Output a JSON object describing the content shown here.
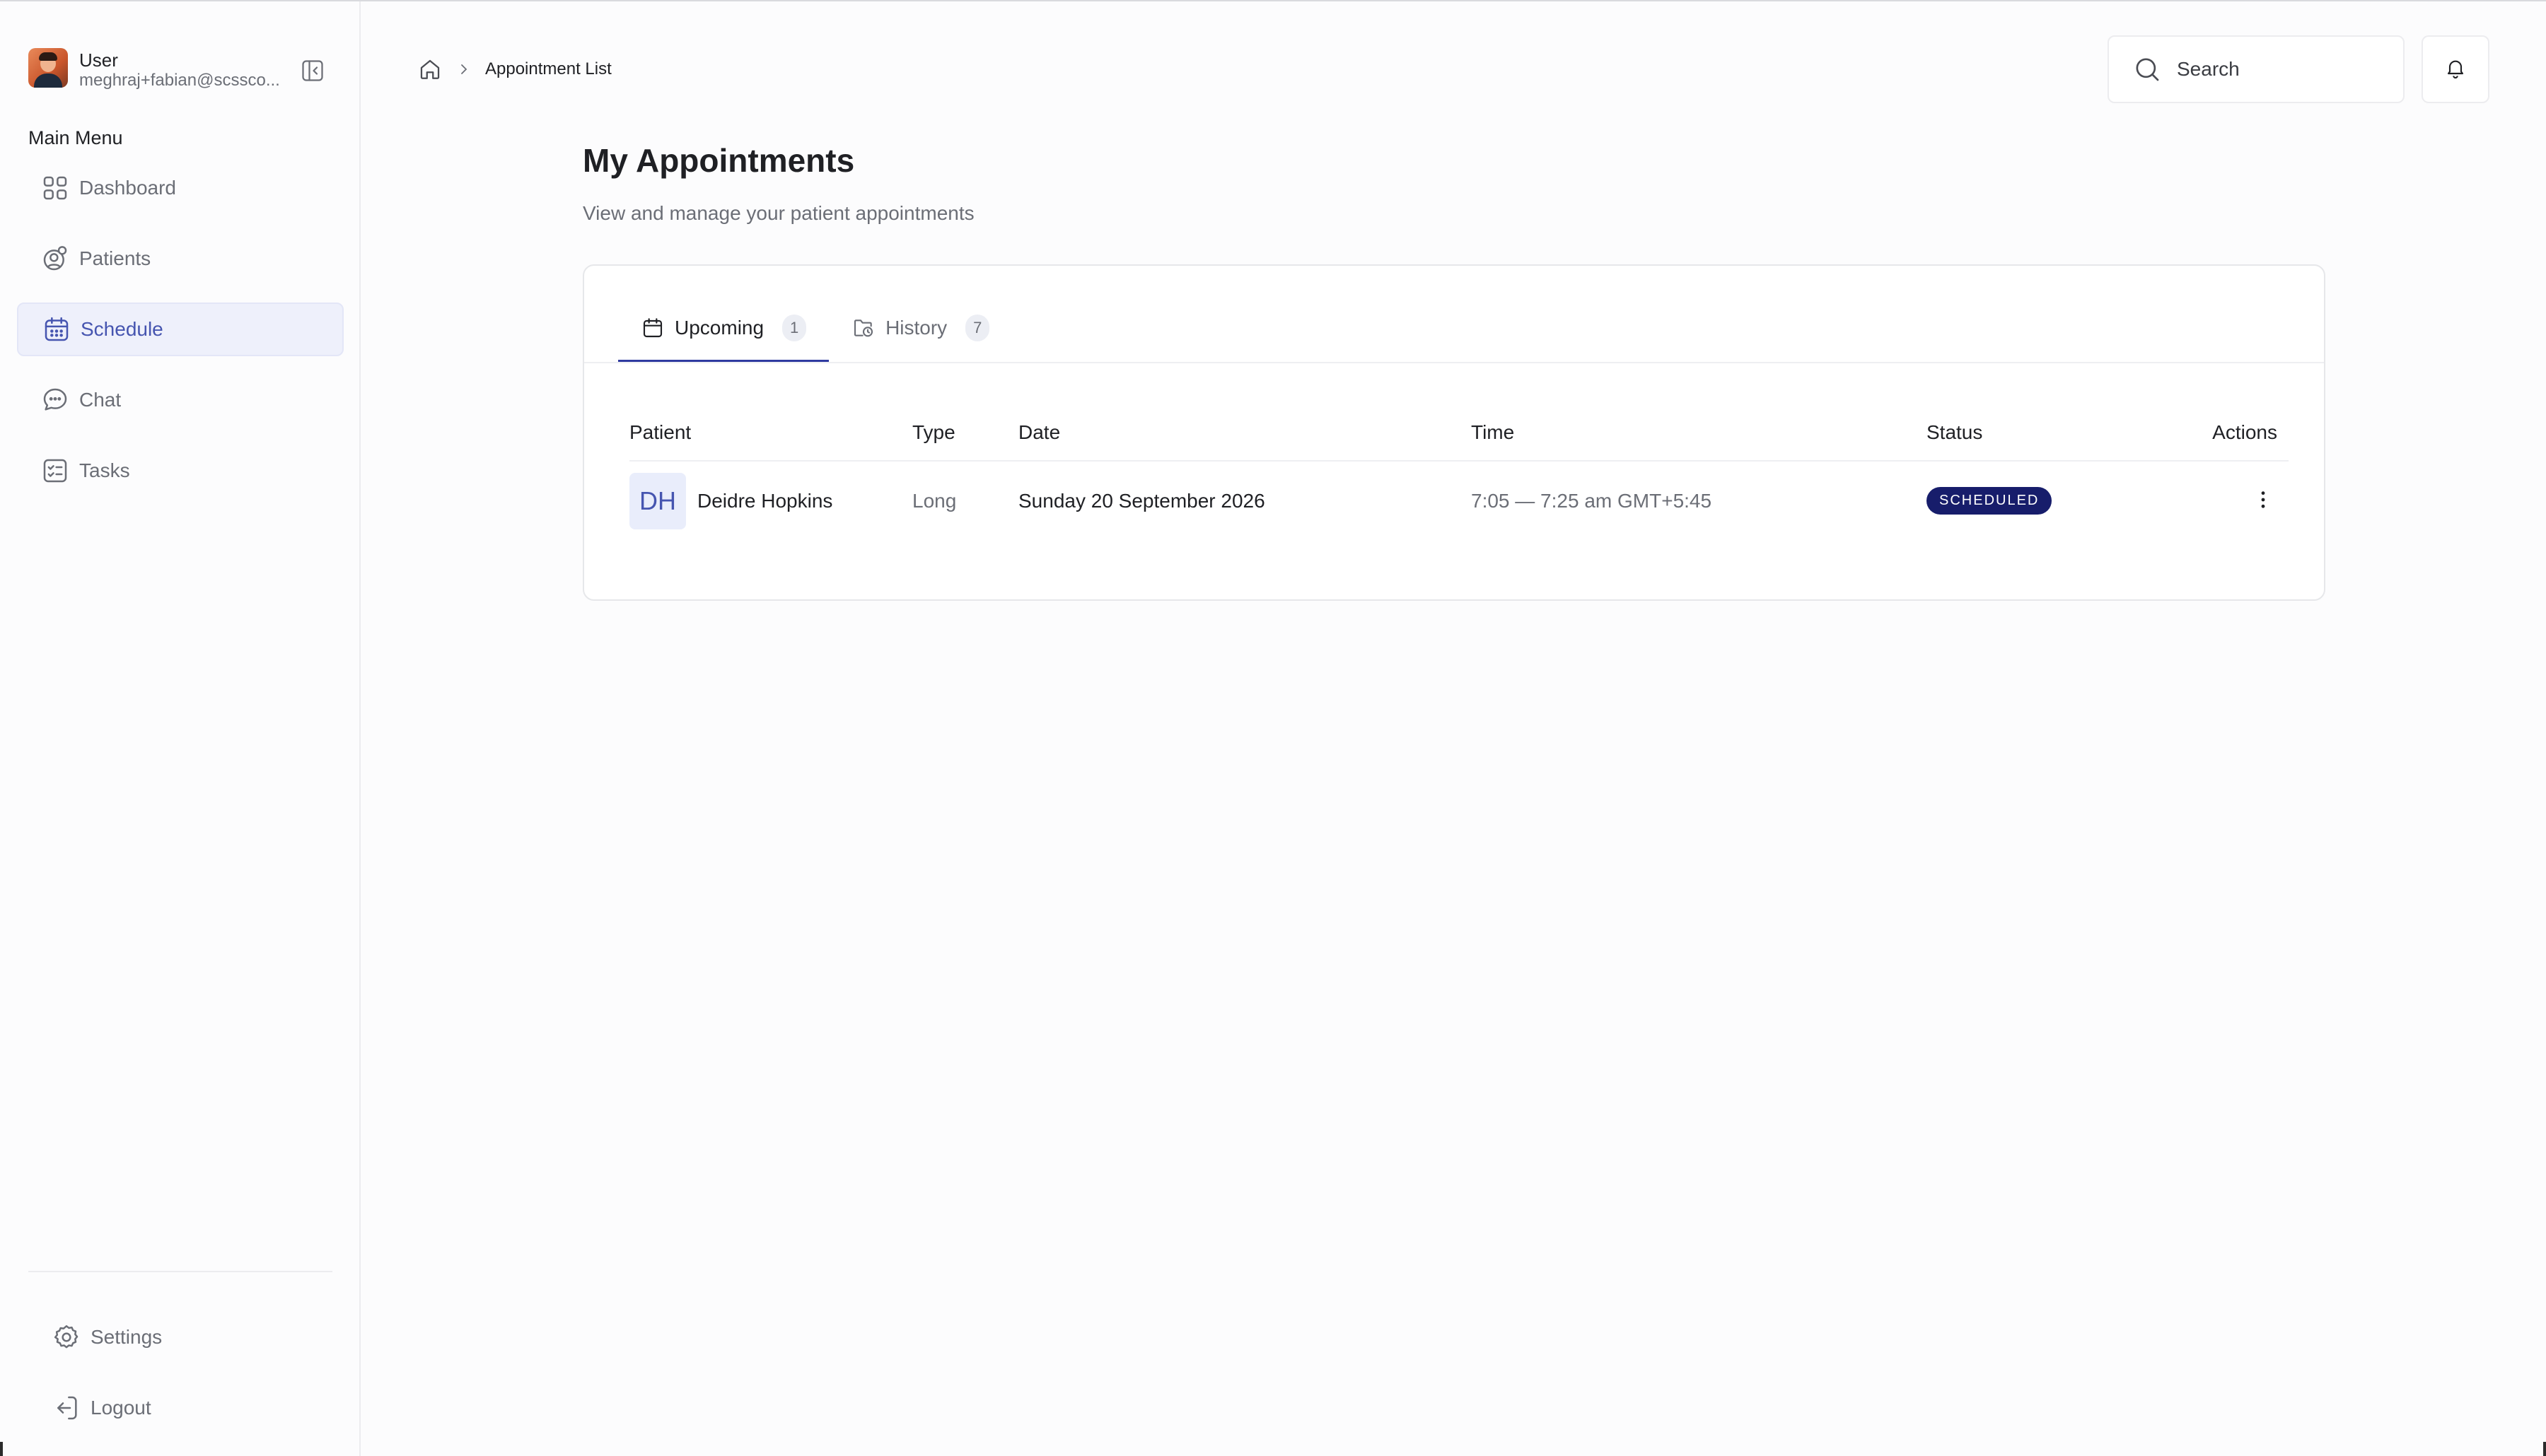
{
  "user": {
    "name": "User",
    "email": "meghraj+fabian@scssco..."
  },
  "sidebar": {
    "heading": "Main Menu",
    "items": [
      {
        "label": "Dashboard",
        "icon": "grid-icon",
        "active": false
      },
      {
        "label": "Patients",
        "icon": "patients-icon",
        "active": false
      },
      {
        "label": "Schedule",
        "icon": "calendar-icon",
        "active": true
      },
      {
        "label": "Chat",
        "icon": "chat-icon",
        "active": false
      },
      {
        "label": "Tasks",
        "icon": "tasks-icon",
        "active": false
      }
    ],
    "bottom": [
      {
        "label": "Settings",
        "icon": "gear-icon"
      },
      {
        "label": "Logout",
        "icon": "logout-icon"
      }
    ]
  },
  "header": {
    "breadcrumb": "Appointment List",
    "search_placeholder": "Search"
  },
  "page": {
    "title": "My Appointments",
    "subtitle": "View and manage your patient appointments"
  },
  "tabs": [
    {
      "label": "Upcoming",
      "count": "1",
      "active": true
    },
    {
      "label": "History",
      "count": "7",
      "active": false
    }
  ],
  "table": {
    "headers": [
      "Patient",
      "Type",
      "Date",
      "Time",
      "Status",
      "Actions"
    ],
    "rows": [
      {
        "initials": "DH",
        "patient": "Deidre Hopkins",
        "type": "Long",
        "date": "Sunday 20 September 2026",
        "time": "7:05 — 7:25 am GMT+5:45",
        "status": "SCHEDULED"
      }
    ]
  },
  "colors": {
    "accent": "#4655b0",
    "active_bg": "#eef0fb",
    "status_scheduled": "#171d6b",
    "tab_underline": "#2f3aa0"
  }
}
